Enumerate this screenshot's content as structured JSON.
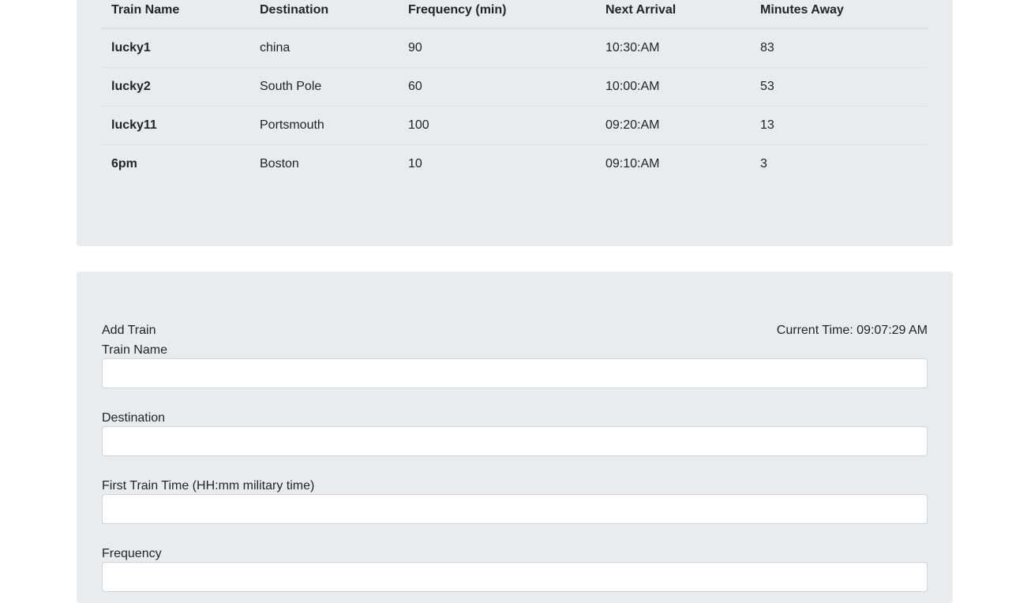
{
  "table": {
    "headers": [
      "Train Name",
      "Destination",
      "Frequency (min)",
      "Next Arrival",
      "Minutes Away"
    ],
    "rows": [
      [
        "lucky1",
        "china",
        "90",
        "10:30:AM",
        "83"
      ],
      [
        "lucky2",
        "South Pole",
        "60",
        "10:00:AM",
        "53"
      ],
      [
        "lucky11",
        "Portsmouth",
        "100",
        "09:20:AM",
        "13"
      ],
      [
        "6pm",
        "Boston",
        "10",
        "09:10:AM",
        "3"
      ]
    ]
  },
  "form": {
    "title": "Add Train",
    "current_time": "Current Time: 09:07:29 AM",
    "fields": [
      {
        "label": "Train Name",
        "value": "",
        "placeholder": ""
      },
      {
        "label": "Destination",
        "value": "",
        "placeholder": ""
      },
      {
        "label": "First Train Time (HH:mm military time)",
        "value": "",
        "placeholder": ""
      },
      {
        "label": "Frequency",
        "value": "",
        "placeholder": ""
      }
    ]
  }
}
